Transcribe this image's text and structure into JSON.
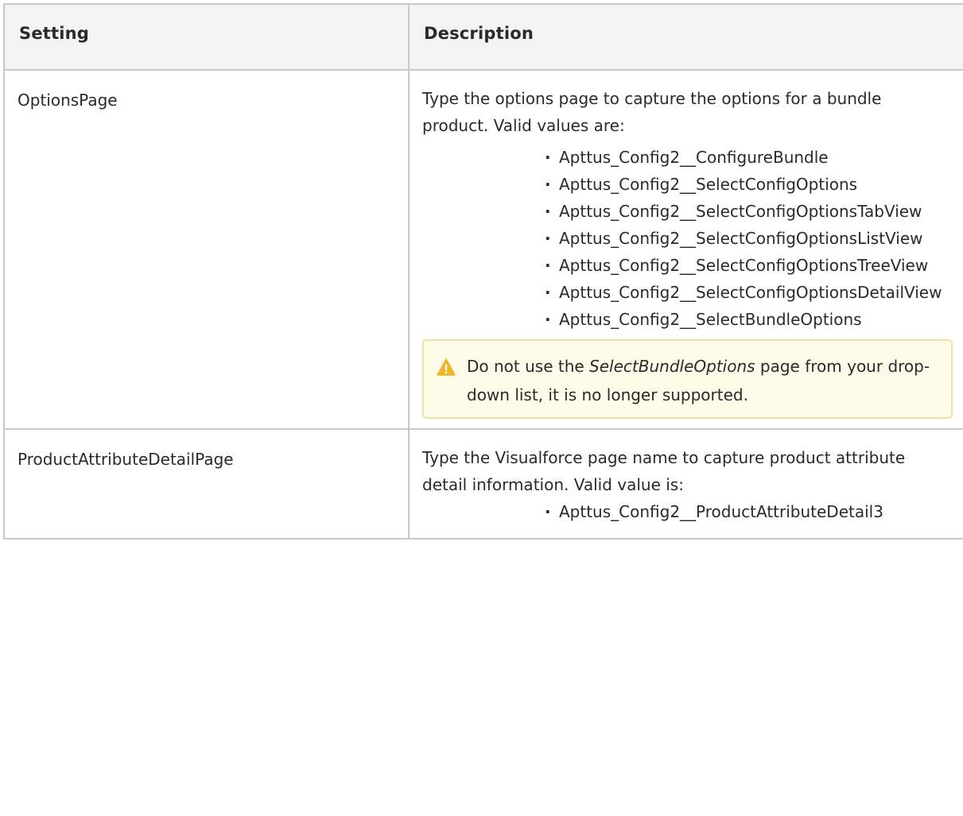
{
  "table": {
    "headers": [
      "Setting",
      "Description"
    ],
    "rows": [
      {
        "setting": "OptionsPage",
        "description": "Type the options page to capture the options for a bundle product. Valid values are:",
        "values": [
          "Apttus_Config2__ConfigureBundle",
          "Apttus_Config2__SelectConfigOptions",
          "Apttus_Config2__SelectConfigOptionsTabView",
          "Apttus_Config2__SelectConfigOptionsListView",
          "Apttus_Config2__SelectConfigOptionsTreeView",
          "Apttus_Config2__SelectConfigOptionsDetailView",
          "Apttus_Config2__SelectBundleOptions"
        ],
        "note": {
          "icon": "warning-icon",
          "before": "Do not use the ",
          "emphasis": "SelectBundleOptions",
          "after": " page from your drop-down list, it is no longer supported."
        }
      },
      {
        "setting": "ProductAttributeDetailPage",
        "description": "Type the Visualforce page name to capture product attribute detail information. Valid value is:",
        "values": [
          "Apttus_Config2__ProductAttributeDetail3"
        ]
      }
    ]
  },
  "colors": {
    "border": "#c9c9c9",
    "header_bg": "#f3f3f3",
    "note_bg": "#fffbe9",
    "note_border": "#f5e0a0",
    "warning": "#f0b429"
  }
}
